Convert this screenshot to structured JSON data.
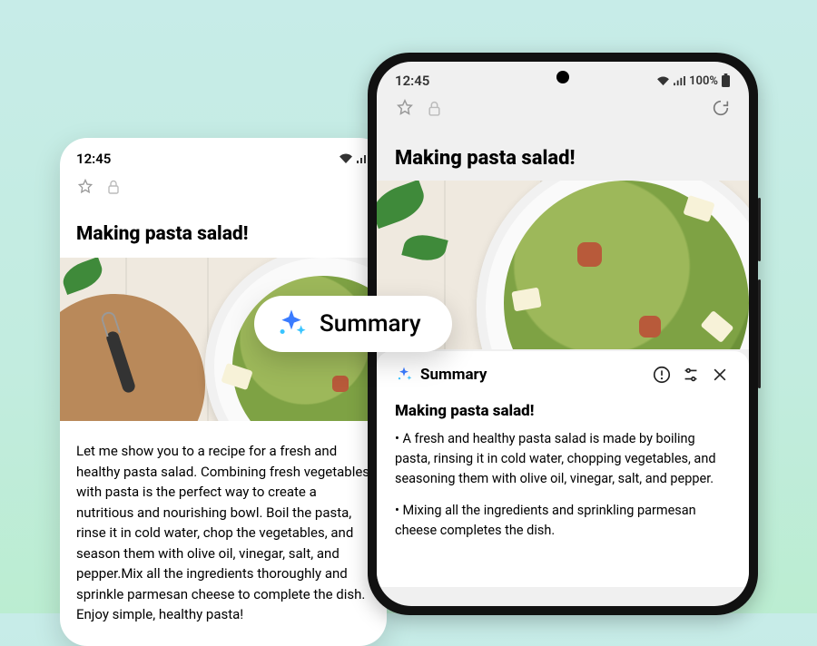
{
  "phone_back": {
    "status": {
      "time": "12:45"
    },
    "note": {
      "title": "Making pasta salad!",
      "body": "Let me show you to a recipe for a fresh and healthy pasta salad. Combining fresh vegetables with pasta is the perfect way to create a nutritious and nourishing bowl. Boil the pasta, rinse it in cold water, chop the vegetables, and season them with olive oil, vinegar, salt, and pepper.Mix all the ingredients thoroughly and sprinkle parmesan cheese to complete the dish. Enjoy simple, healthy pasta!"
    }
  },
  "phone_front": {
    "status": {
      "time": "12:45",
      "battery_text": "100%"
    },
    "note": {
      "title": "Making pasta salad!"
    },
    "summary": {
      "label": "Summary",
      "heading": "Making pasta salad!",
      "bullets": [
        "• A fresh and healthy pasta salad is made by boiling pasta, rinsing it in cold water, chopping vegetables, and seasoning them with olive oil, vinegar, salt, and pepper.",
        "• Mixing all the ingredients and sprinkling parmesan cheese completes the dish."
      ]
    }
  },
  "pill": {
    "label": "Summary"
  },
  "icons": {
    "sparkle": "sparkle-icon",
    "star": "star-icon",
    "lock": "lock-icon",
    "refresh": "refresh-icon",
    "warning": "warning-icon",
    "adjust": "adjust-icon",
    "close": "close-icon",
    "wifi": "wifi-icon",
    "signal": "signal-icon",
    "battery": "battery-icon"
  },
  "colors": {
    "ai_blue": "#3a7bff",
    "ai_cyan": "#39c4ff"
  }
}
